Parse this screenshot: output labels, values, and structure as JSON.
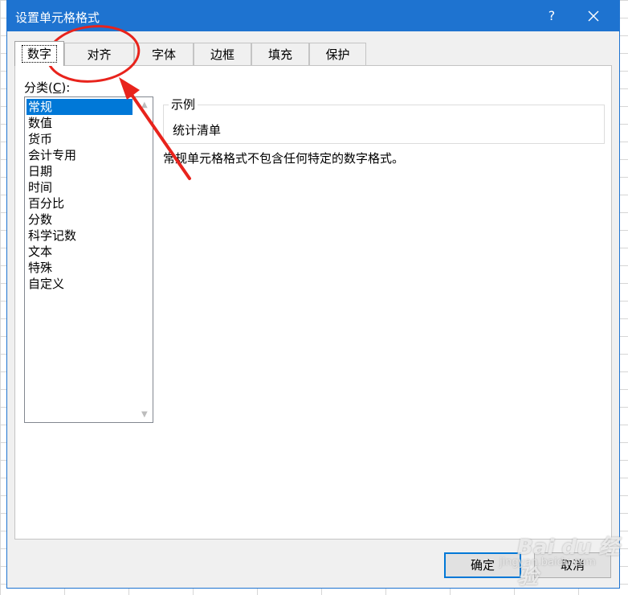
{
  "dialog": {
    "title": "设置单元格格式",
    "help_glyph": "?",
    "close_icon": "close-icon"
  },
  "tabs": [
    {
      "label": "数字",
      "active": true
    },
    {
      "label": "对齐",
      "active": false
    },
    {
      "label": "字体",
      "active": false
    },
    {
      "label": "边框",
      "active": false
    },
    {
      "label": "填充",
      "active": false
    },
    {
      "label": "保护",
      "active": false
    }
  ],
  "category": {
    "label_prefix": "分类(",
    "label_accel": "C",
    "label_suffix": "):",
    "items": [
      "常规",
      "数值",
      "货币",
      "会计专用",
      "日期",
      "时间",
      "百分比",
      "分数",
      "科学记数",
      "文本",
      "特殊",
      "自定义"
    ],
    "selected": "常规"
  },
  "sample": {
    "legend": "示例",
    "value": "统计清单"
  },
  "description": "常规单元格格式不包含任何特定的数字格式。",
  "buttons": {
    "ok": "确定",
    "cancel": "取消"
  },
  "watermark": {
    "brand": "Bai du 经验",
    "url": "jingyan.baidu.com"
  },
  "colors": {
    "titlebar": "#1e73d0",
    "selection": "#0078d7",
    "annotation": "#e8231c"
  }
}
